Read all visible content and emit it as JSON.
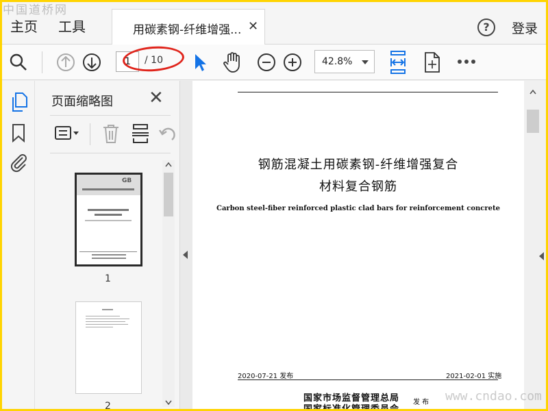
{
  "watermarks": {
    "top_left": "中国道桥网",
    "bottom_right": "www.cndao.com"
  },
  "tabbar": {
    "home": "主页",
    "tools": "工具",
    "active_tab_title": "用碳素钢-纤维增强...",
    "help_label": "?",
    "login": "登录"
  },
  "toolbar": {
    "current_page": "1",
    "total_pages": "/ 10",
    "zoom": "42.8%"
  },
  "thumbnail_panel": {
    "title": "页面缩略图",
    "thumbnails": [
      {
        "page_number": "1",
        "selected": true
      },
      {
        "page_number": "2",
        "selected": false
      }
    ]
  },
  "document": {
    "title_line1": "钢筋混凝土用碳素钢-纤维增强复合",
    "title_line2": "材料复合钢筋",
    "english_title": "Carbon steel-fiber reinforced plastic clad bars for reinforcement concrete",
    "release_date": "2020-07-21 发布",
    "implement_date": "2021-02-01 实施",
    "issuer_line1": "国家市场监督管理总局",
    "issuer_line2": "国家标准化管理委员会",
    "publish_label": "发 布"
  },
  "colors": {
    "accent_blue": "#1473e6",
    "highlight_red": "#e0251c",
    "frame_yellow": "#ffd400"
  }
}
